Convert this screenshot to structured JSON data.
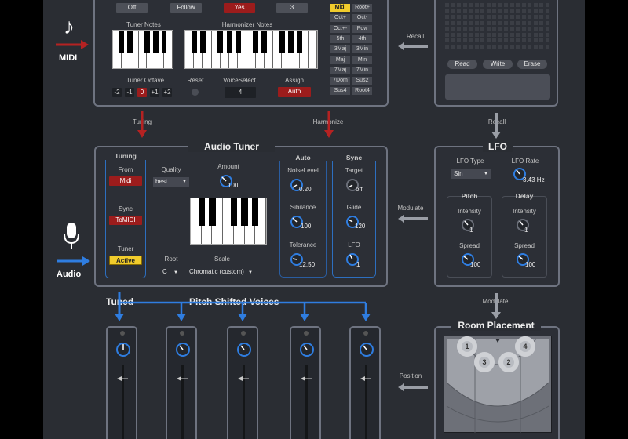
{
  "top_options": [
    "Off",
    "Follow",
    "Yes",
    "3"
  ],
  "midi": {
    "label": "MIDI"
  },
  "audio": {
    "label": "Audio"
  },
  "keyboards": {
    "tuner_notes": "Tuner Notes",
    "harmonizer_notes": "Harmonizer Notes"
  },
  "tuner_octave": {
    "label": "Tuner Octave",
    "options": [
      "-2",
      "-1",
      "0",
      "+1",
      "+2"
    ],
    "selected": "0"
  },
  "reset": {
    "label": "Reset"
  },
  "voice_select": {
    "label": "VoiceSelect",
    "value": "4"
  },
  "assign": {
    "label": "Assign",
    "value": "Auto"
  },
  "chords": [
    "Midi",
    "Root+",
    "Oct+",
    "Oct-",
    "Oct+-",
    "Pow",
    "5th",
    "4th",
    "3Maj",
    "3Min",
    "Maj",
    "Min",
    "7Maj",
    "7Min",
    "7Dom",
    "Sus2",
    "Sus4",
    "Root4"
  ],
  "chord_selected": "Midi",
  "memory": {
    "read": "Read",
    "write": "Write",
    "erase": "Erase"
  },
  "flow": {
    "recall_top": "Recall",
    "recall": "Recall",
    "tuning": "Tuning",
    "harmonize": "Harmonize",
    "modulate_left": "Modulate",
    "modulate_down": "Modulate",
    "position": "Position",
    "tuned": "Tuned",
    "pitch_shifted": "Pitch Shifted Voices"
  },
  "audio_tuner": {
    "title": "Audio Tuner",
    "tuning": {
      "title": "Tuning",
      "from_label": "From",
      "from_value": "Midi",
      "sync_label": "Sync",
      "sync_value": "ToMIDI",
      "tuner_label": "Tuner",
      "tuner_value": "Active"
    },
    "quality": {
      "label": "Quality",
      "value": "best"
    },
    "amount": {
      "label": "Amount",
      "value": "100"
    },
    "root": {
      "label": "Root",
      "value": "C"
    },
    "scale": {
      "label": "Scale",
      "value": "Chromatic (custom)"
    },
    "auto": {
      "title": "Auto",
      "noise_label": "NoiseLevel",
      "noise_value": "0.20",
      "sibilance_label": "Sibilance",
      "sibilance_value": "100",
      "tolerance_label": "Tolerance",
      "tolerance_value": "12.50"
    },
    "sync": {
      "title": "Sync",
      "target_label": "Target",
      "target_value": "off",
      "glide_label": "Glide",
      "glide_value": "120",
      "lfo_label": "LFO",
      "lfo_value": "1"
    }
  },
  "lfo": {
    "title": "LFO",
    "type_label": "LFO Type",
    "type_value": "Sin",
    "rate_label": "LFO Rate",
    "rate_value": "3.43 Hz",
    "pitch": {
      "title": "Pitch",
      "intensity_label": "Intensity",
      "intensity_value": "1",
      "spread_label": "Spread",
      "spread_value": "100"
    },
    "delay": {
      "title": "Delay",
      "intensity_label": "Intensity",
      "intensity_value": "1",
      "spread_label": "Spread",
      "spread_value": "100"
    }
  },
  "room": {
    "title": "Room Placement",
    "voices": [
      "1",
      "2",
      "3",
      "4"
    ]
  },
  "colors": {
    "background": "#2a2d33",
    "panel_border": "#6e7380",
    "accent_red": "#9c1c1c",
    "accent_yellow": "#f1cc2c",
    "accent_blue": "#2d6fc0",
    "midi_arrow": "#b52222",
    "audio_arrow": "#2f7de0"
  }
}
